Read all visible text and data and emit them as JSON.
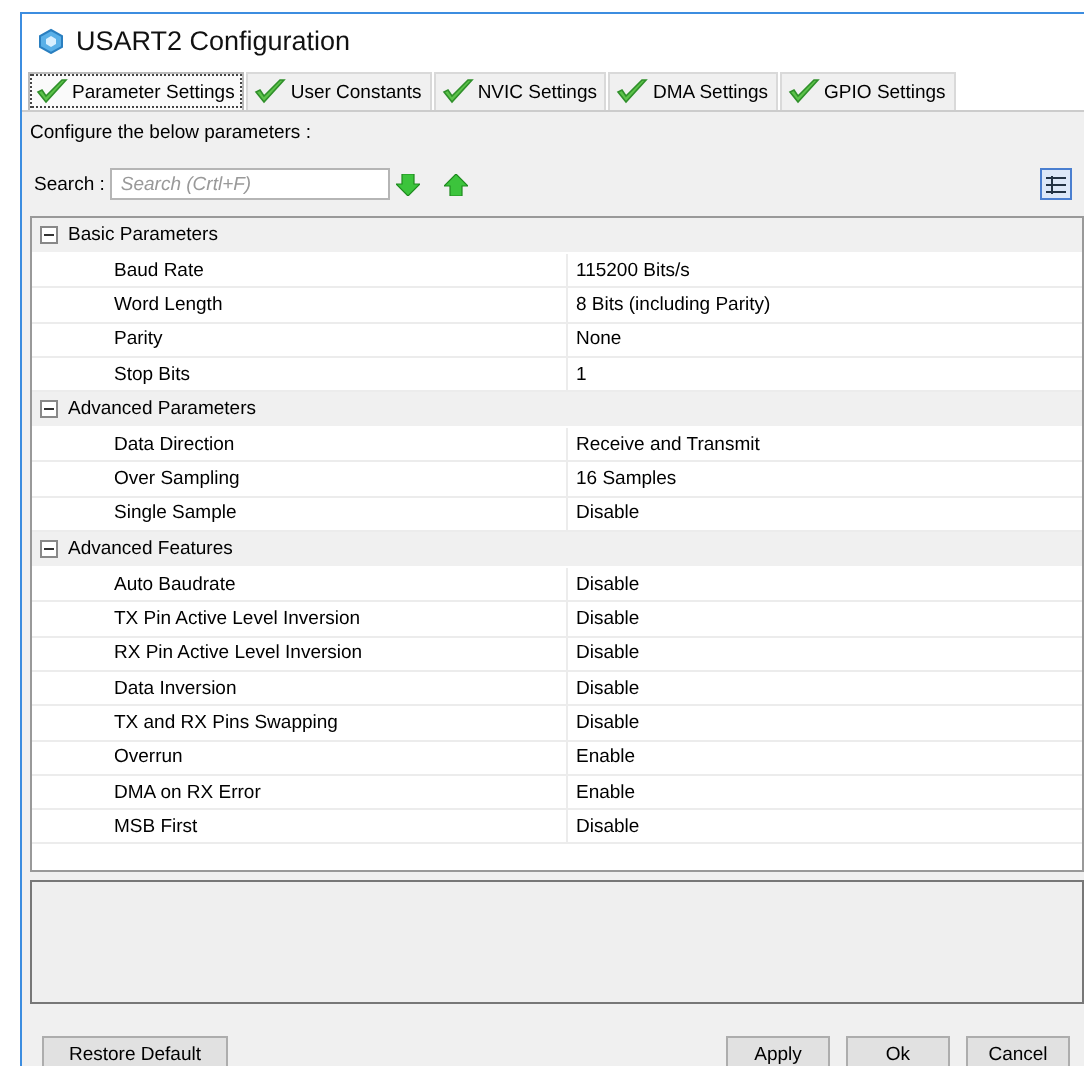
{
  "window": {
    "title": "USART2 Configuration"
  },
  "tabs": [
    {
      "label": "Parameter Settings",
      "selected": true
    },
    {
      "label": "User Constants",
      "selected": false
    },
    {
      "label": "NVIC Settings",
      "selected": false
    },
    {
      "label": "DMA Settings",
      "selected": false
    },
    {
      "label": "GPIO Settings",
      "selected": false
    }
  ],
  "instruction": "Configure the below parameters :",
  "search": {
    "label": "Search :",
    "placeholder": "Search (Crtl+F)"
  },
  "groups": [
    {
      "title": "Basic Parameters",
      "expanded": true,
      "rows": [
        {
          "name": "Baud Rate",
          "value": "115200 Bits/s"
        },
        {
          "name": "Word Length",
          "value": "8 Bits (including Parity)"
        },
        {
          "name": "Parity",
          "value": "None"
        },
        {
          "name": "Stop Bits",
          "value": "1"
        }
      ]
    },
    {
      "title": "Advanced Parameters",
      "expanded": true,
      "rows": [
        {
          "name": "Data Direction",
          "value": "Receive and Transmit"
        },
        {
          "name": "Over Sampling",
          "value": "16 Samples"
        },
        {
          "name": "Single Sample",
          "value": "Disable"
        }
      ]
    },
    {
      "title": "Advanced Features",
      "expanded": true,
      "rows": [
        {
          "name": "Auto Baudrate",
          "value": "Disable"
        },
        {
          "name": "TX Pin Active Level Inversion",
          "value": "Disable"
        },
        {
          "name": "RX Pin Active Level Inversion",
          "value": "Disable"
        },
        {
          "name": "Data Inversion",
          "value": "Disable"
        },
        {
          "name": "TX and RX Pins Swapping",
          "value": "Disable"
        },
        {
          "name": "Overrun",
          "value": "Enable"
        },
        {
          "name": "DMA on RX Error",
          "value": "Enable"
        },
        {
          "name": "MSB First",
          "value": "Disable"
        }
      ]
    }
  ],
  "buttons": {
    "left": [
      "Restore Default"
    ],
    "right": [
      "Apply",
      "Ok",
      "Cancel"
    ]
  }
}
